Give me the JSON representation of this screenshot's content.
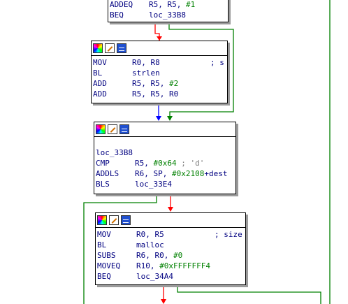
{
  "colors": {
    "false_edge": "#ff0000",
    "true_edge": "#008000",
    "uncond_edge": "#0000ff",
    "border": "#000000",
    "shadow": "#9a9a9a",
    "text": "#000080",
    "number": "#008000",
    "comment": "#7f7f7f"
  },
  "icons": [
    "color-palette-icon",
    "edit-pencil-icon",
    "graph-view-icon"
  ],
  "block0": {
    "lines": [
      {
        "mn": "ADDEQ",
        "op": "R5, R5, ",
        "num": "#1",
        "tail": ""
      },
      {
        "mn": "BEQ",
        "op": "loc_33B8",
        "num": "",
        "tail": ""
      }
    ]
  },
  "block1": {
    "lines": [
      {
        "mn": "MOV",
        "op": "R0, R8",
        "num": "",
        "tail": "",
        "comment": "; s"
      },
      {
        "mn": "BL",
        "op": "strlen",
        "num": "",
        "tail": ""
      },
      {
        "mn": "ADD",
        "op": "R5, R5, ",
        "num": "#2",
        "tail": ""
      },
      {
        "mn": "ADD",
        "op": "R5, R5, R0",
        "num": "",
        "tail": ""
      }
    ]
  },
  "block2": {
    "label": "loc_33B8",
    "lines": [
      {
        "mn": "CMP",
        "op": "R5, ",
        "num": "#0x64",
        "tail": "",
        "comment": " ; 'd'"
      },
      {
        "mn": "ADDLS",
        "op": "R6, SP, ",
        "num": "#0x2108",
        "tail": "+dest"
      },
      {
        "mn": "BLS",
        "op": "loc_33E4",
        "num": "",
        "tail": ""
      }
    ]
  },
  "block3": {
    "lines": [
      {
        "mn": "MOV",
        "op": "R0, R5",
        "num": "",
        "tail": "",
        "comment": "; size"
      },
      {
        "mn": "BL",
        "op": "malloc",
        "num": "",
        "tail": ""
      },
      {
        "mn": "SUBS",
        "op": "R6, R0, ",
        "num": "#0",
        "tail": ""
      },
      {
        "mn": "MOVEQ",
        "op": "R10, ",
        "num": "#0xFFFFFFF4",
        "tail": ""
      },
      {
        "mn": "BEQ",
        "op": "loc_34A4",
        "num": "",
        "tail": ""
      }
    ]
  }
}
